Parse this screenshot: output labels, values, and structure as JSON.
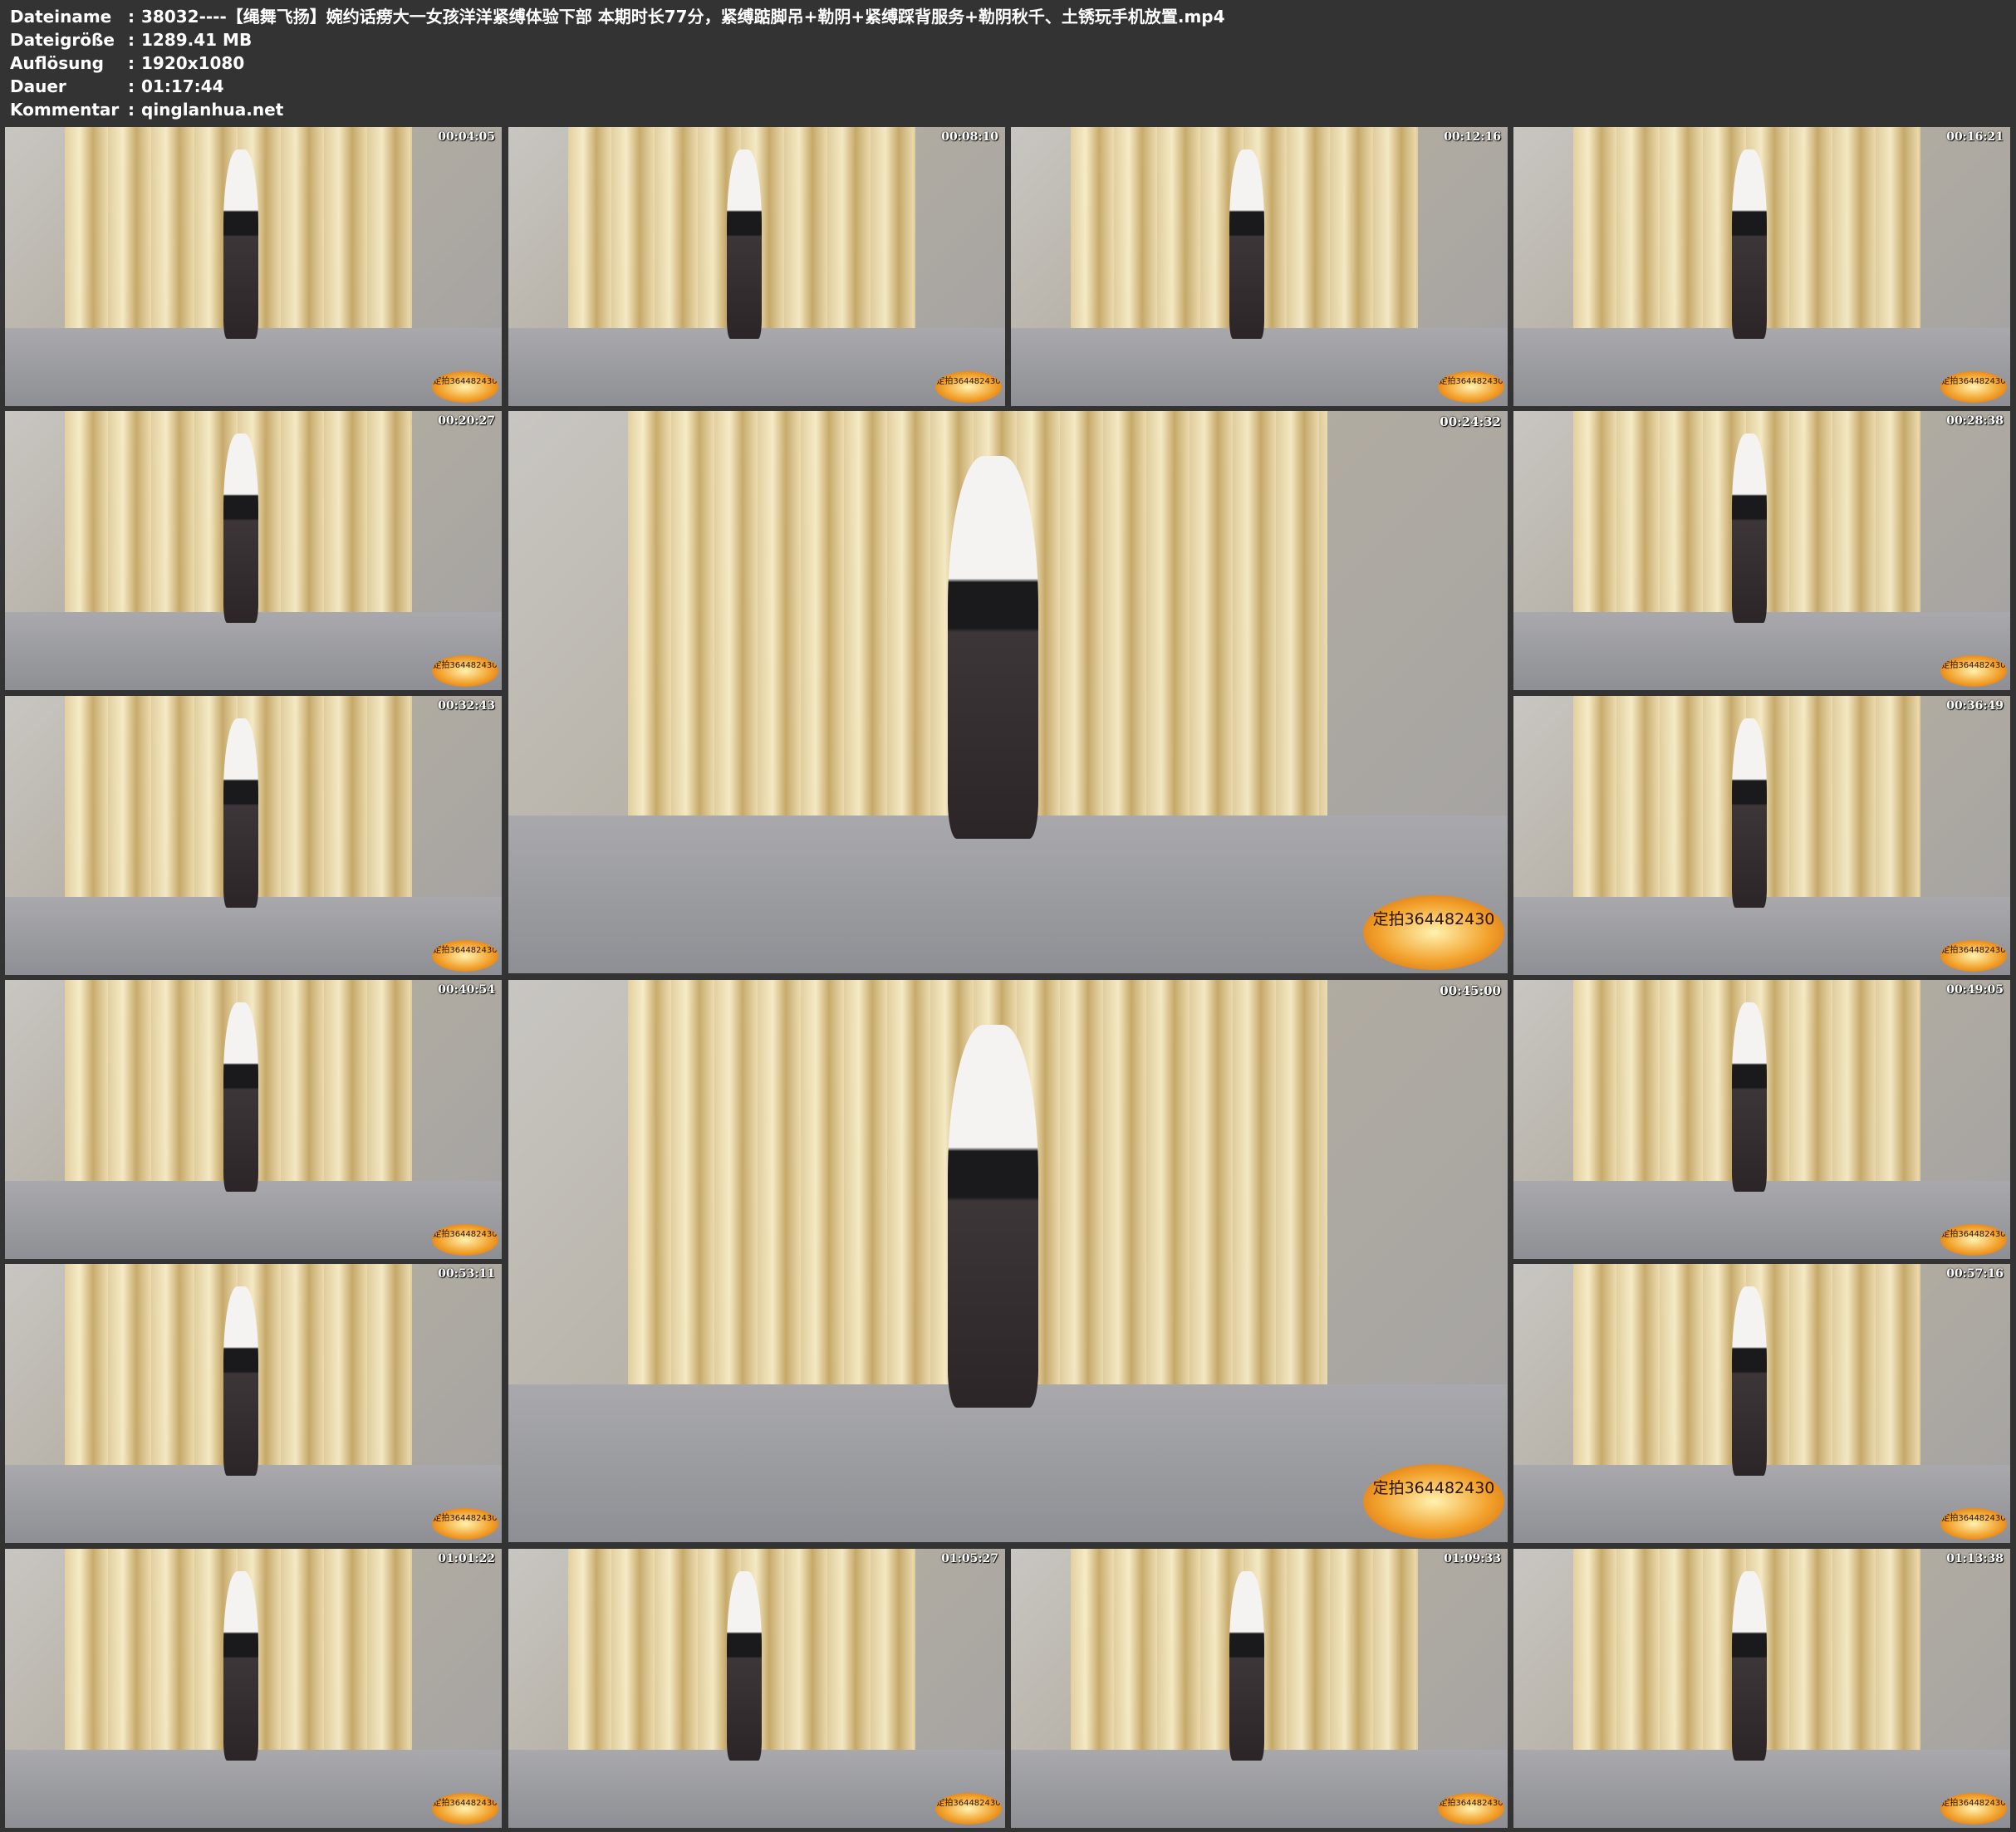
{
  "header": {
    "rows": [
      {
        "label": "Dateiname",
        "sep": ":",
        "value": "38032----【绳舞飞扬】婉约话痨大一女孩洋洋紧缚体验下部 本期时长77分，紧缚踮脚吊+勒阴+紧缚踩背服务+勒阴秋千、土锈玩手机放置.mp4"
      },
      {
        "label": "Dateigröße",
        "sep": ":",
        "value": "1289.41 MB"
      },
      {
        "label": "Auflösung",
        "sep": ":",
        "value": "1920x1080"
      },
      {
        "label": "Dauer",
        "sep": ":",
        "value": "01:17:44"
      },
      {
        "label": "Kommentar",
        "sep": ":",
        "value": "qinglanhua.net"
      }
    ]
  },
  "watermark": "定拍364482430",
  "thumbnails": [
    {
      "time": "00:04:05",
      "big": false
    },
    {
      "time": "00:08:10",
      "big": false
    },
    {
      "time": "00:12:16",
      "big": false
    },
    {
      "time": "00:16:21",
      "big": false
    },
    {
      "time": "00:20:27",
      "big": false
    },
    {
      "time": "00:24:32",
      "big": true
    },
    {
      "time": "00:28:38",
      "big": false
    },
    {
      "time": "00:32:43",
      "big": false
    },
    {
      "time": "00:36:49",
      "big": false
    },
    {
      "time": "00:40:54",
      "big": false
    },
    {
      "time": "00:45:00",
      "big": true
    },
    {
      "time": "00:49:05",
      "big": false
    },
    {
      "time": "00:53:11",
      "big": false
    },
    {
      "time": "00:57:16",
      "big": false
    },
    {
      "time": "01:01:22",
      "big": false
    },
    {
      "time": "01:05:27",
      "big": false
    },
    {
      "time": "01:09:33",
      "big": false
    },
    {
      "time": "01:13:38",
      "big": false
    }
  ]
}
